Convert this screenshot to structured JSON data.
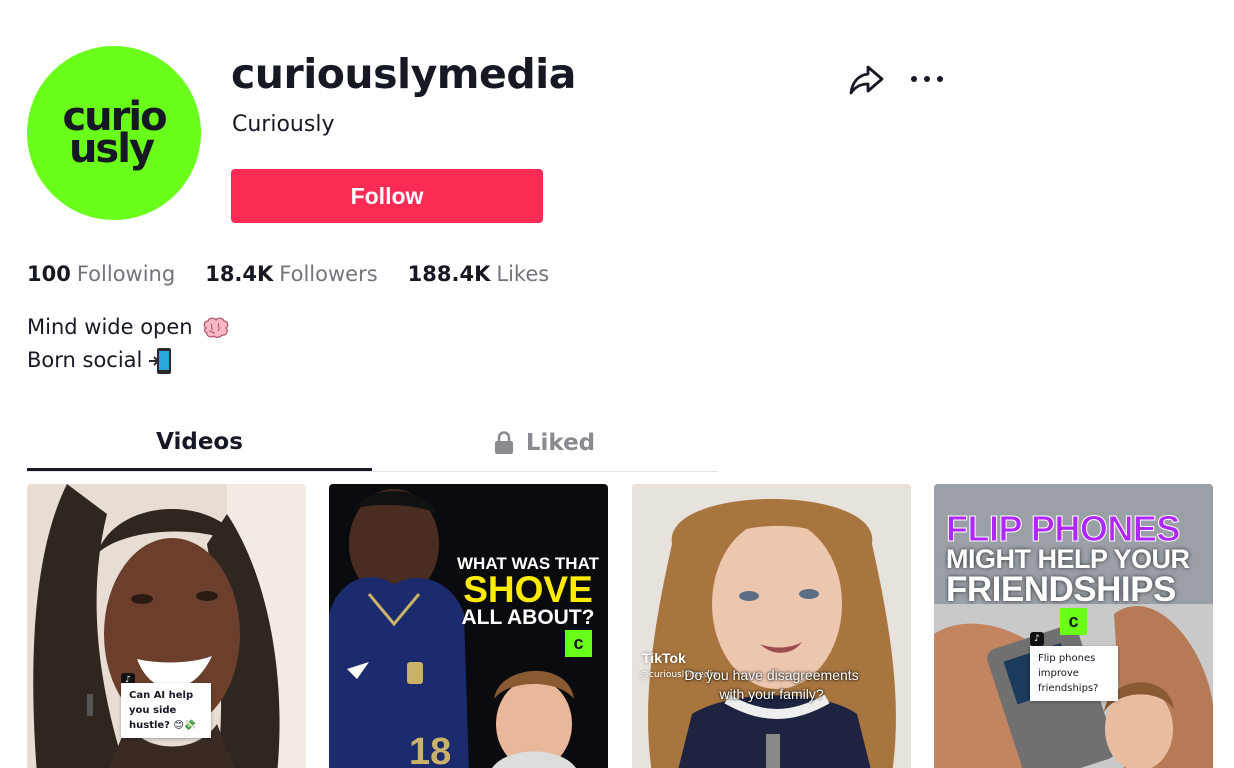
{
  "profile": {
    "avatar_text_line1": "curio",
    "avatar_text_line2": "usly",
    "username": "curiouslymedia",
    "nickname": "Curiously",
    "follow_label": "Follow",
    "accent_color": "#fe2c55",
    "avatar_color": "#69ff1a"
  },
  "stats": [
    {
      "count": "100",
      "label": "Following"
    },
    {
      "count": "18.4K",
      "label": "Followers"
    },
    {
      "count": "188.4K",
      "label": "Likes"
    }
  ],
  "bio": {
    "line1": "Mind wide open",
    "line1_icon": "brain-icon",
    "line2": "Born social",
    "line2_icon": "mobile-phone-arrow-icon"
  },
  "header_actions": {
    "share_icon": "share-icon",
    "more_icon": "more-icon"
  },
  "tabs": [
    {
      "label": "Videos",
      "active": true
    },
    {
      "label": "Liked",
      "active": false,
      "icon": "lock-icon"
    }
  ],
  "videos": [
    {
      "caption_card": "Can AI help you side hustle? 😊💸"
    },
    {
      "overlay_line1": "WHAT WAS THAT",
      "overlay_line2": "SHOVE",
      "overlay_line3": "ALL ABOUT?",
      "badge": "c"
    },
    {
      "watermark": "TikTok",
      "handle": "@curiouslymedia",
      "subtitle_line1": "Do you have disagreements",
      "subtitle_line2": "with your family?"
    },
    {
      "title_line1": "FLIP PHONES",
      "title_line2": "MIGHT HELP YOUR",
      "title_line3": "FRIENDSHIPS",
      "badge": "c",
      "caption_card": "Flip phones improve friendships?"
    }
  ]
}
